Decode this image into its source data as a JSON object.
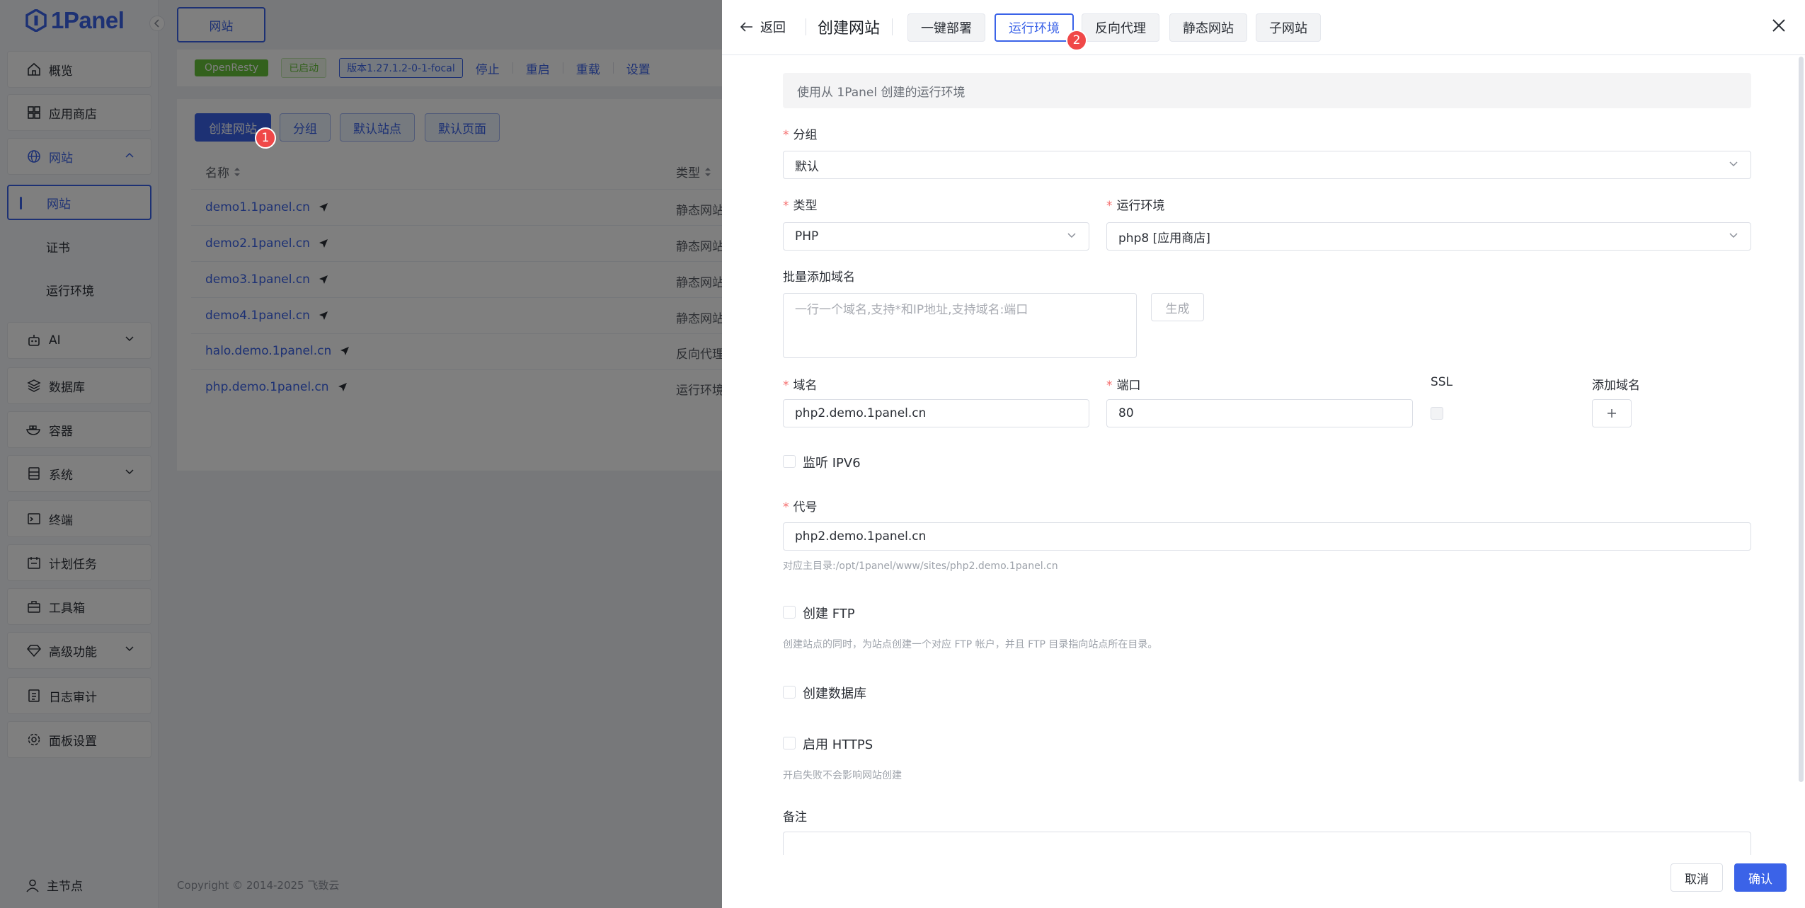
{
  "app": {
    "logo_text": "1Panel"
  },
  "sidebar": {
    "items": [
      {
        "label": "概览"
      },
      {
        "label": "应用商店"
      },
      {
        "label": "网站"
      },
      {
        "label": "AI"
      },
      {
        "label": "数据库"
      },
      {
        "label": "容器"
      },
      {
        "label": "系统"
      },
      {
        "label": "终端"
      },
      {
        "label": "计划任务"
      },
      {
        "label": "工具箱"
      },
      {
        "label": "高级功能"
      },
      {
        "label": "日志审计"
      },
      {
        "label": "面板设置"
      }
    ],
    "sub_items": [
      {
        "label": "网站"
      },
      {
        "label": "证书"
      },
      {
        "label": "运行环境"
      }
    ],
    "bottom_label": "主节点"
  },
  "main": {
    "top_tab": "网站",
    "status": {
      "openresty": "OpenResty",
      "auto": "已启动",
      "version": "版本1.27.1.2-0-1-focal",
      "actions": [
        "停止",
        "重启",
        "重载",
        "设置"
      ]
    },
    "toolbar": {
      "create": "创建网站",
      "group": "分组",
      "default_site": "默认站点",
      "default_page": "默认页面"
    },
    "table": {
      "col_name": "名称",
      "col_type": "类型",
      "rows": [
        {
          "name": "demo1.1panel.cn",
          "type": "静态网站"
        },
        {
          "name": "demo2.1panel.cn",
          "type": "静态网站"
        },
        {
          "name": "demo3.1panel.cn",
          "type": "静态网站"
        },
        {
          "name": "demo4.1panel.cn",
          "type": "静态网站"
        },
        {
          "name": "halo.demo.1panel.cn",
          "type": "反向代理"
        },
        {
          "name": "php.demo.1panel.cn",
          "type": "运行环境"
        }
      ]
    },
    "footer": "Copyright © 2014-2025 飞致云"
  },
  "badges": {
    "first": "1",
    "second": "2"
  },
  "drawer": {
    "back_label": "返回",
    "title": "创建网站",
    "tabs": [
      "一键部署",
      "运行环境",
      "反向代理",
      "静态网站",
      "子网站"
    ],
    "active_tab_index": 1,
    "info": "使用从 1Panel 创建的运行环境",
    "group_label": "分组",
    "group_value": "默认",
    "type_label": "类型",
    "type_value": "PHP",
    "runtime_label": "运行环境",
    "runtime_value": "php8 [应用商店]",
    "batch_label": "批量添加域名",
    "batch_placeholder": "一行一个域名,支持*和IP地址,支持域名:端口",
    "generate_label": "生成",
    "domain_label": "域名",
    "domain_value": "php2.demo.1panel.cn",
    "port_label": "端口",
    "port_value": "80",
    "ssl_label": "SSL",
    "add_domain_label": "添加域名",
    "ipv6_label": "监听 IPV6",
    "alias_label": "代号",
    "alias_value": "php2.demo.1panel.cn",
    "alias_hint": "对应主目录:/opt/1panel/www/sites/php2.demo.1panel.cn",
    "ftp_label": "创建 FTP",
    "ftp_hint": "创建站点的同时，为站点创建一个对应 FTP 帐户，并且 FTP 目录指向站点所在目录。",
    "db_label": "创建数据库",
    "https_label": "启用 HTTPS",
    "https_hint": "开启失败不会影响网站创建",
    "remark_label": "备注",
    "cancel_label": "取消",
    "confirm_label": "确认"
  },
  "colors": {
    "accent": "#3b63e8",
    "badge": "#f04848",
    "success": "#67c23a",
    "required": "#f56c6c"
  }
}
